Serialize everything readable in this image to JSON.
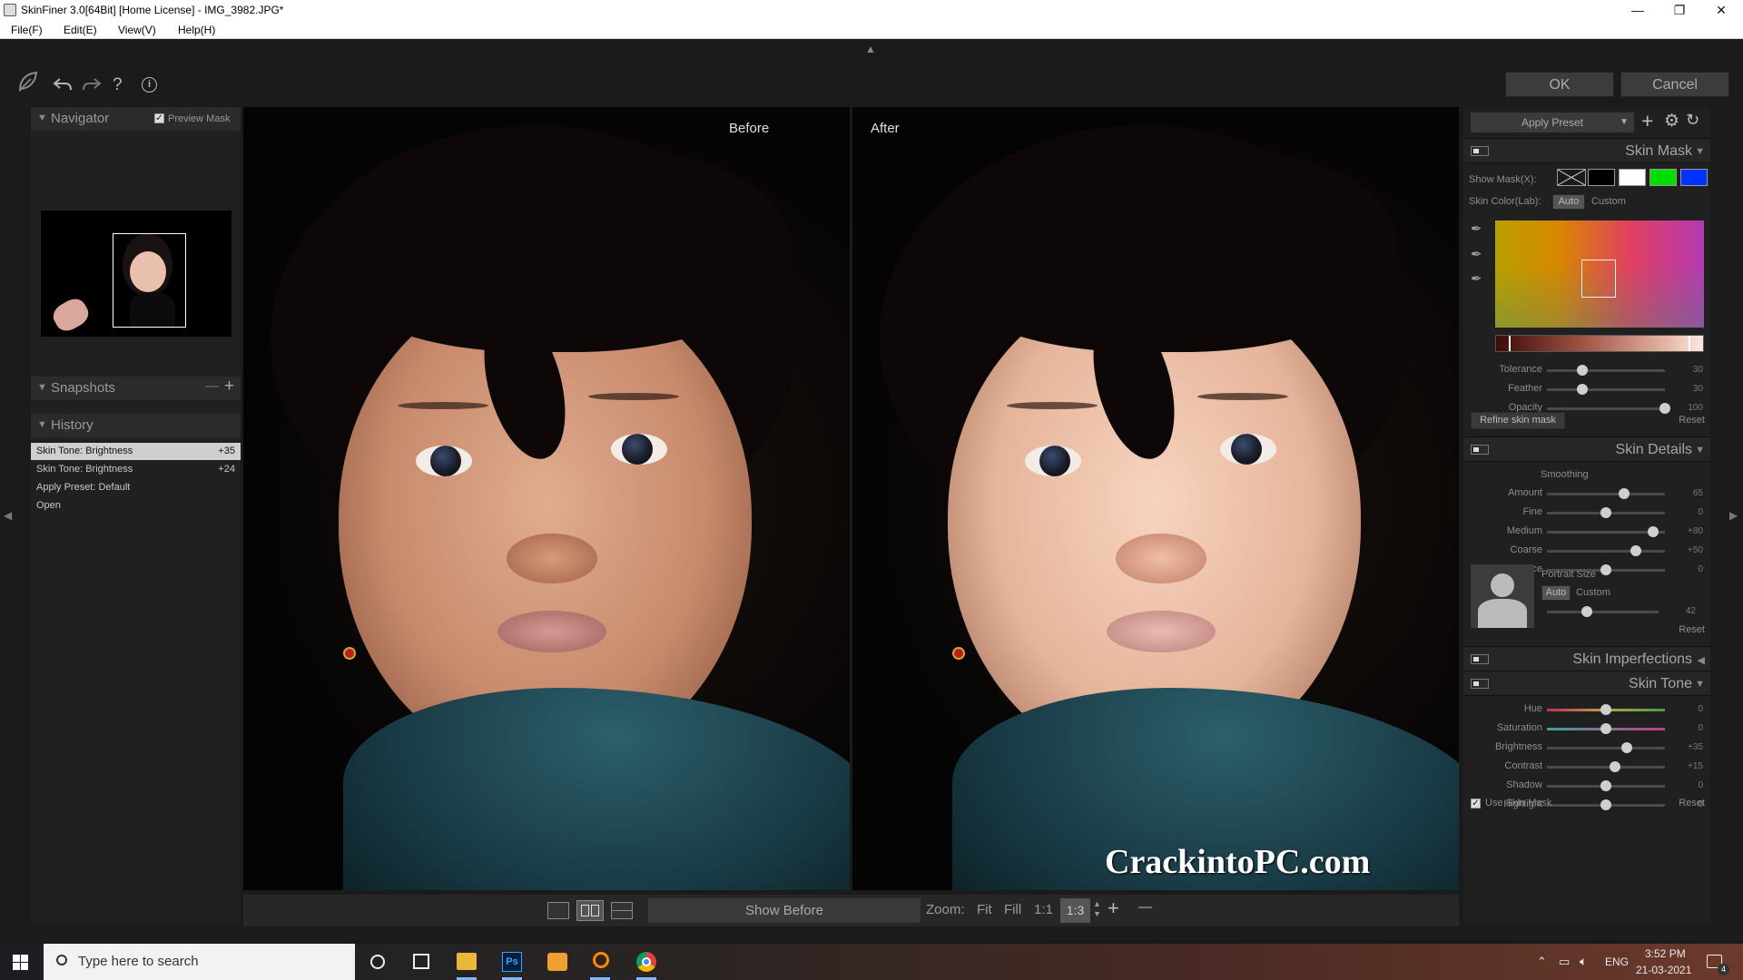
{
  "window": {
    "title": "SkinFiner 3.0[64Bit] [Home License] - IMG_3982.JPG*",
    "minimize": "—",
    "maximize": "❐",
    "close": "✕"
  },
  "menu": [
    "File(F)",
    "Edit(E)",
    "View(V)",
    "Help(H)"
  ],
  "toolbar": {
    "ok_label": "OK",
    "cancel_label": "Cancel",
    "help_glyph": "?",
    "info_glyph": "i"
  },
  "navigator": {
    "title": "Navigator",
    "preview_mask_label": "Preview Mask",
    "preview_mask_checked": true
  },
  "snapshots": {
    "title": "Snapshots",
    "remove_glyph": "—",
    "add_glyph": "+"
  },
  "history": {
    "title": "History",
    "items": [
      {
        "label": "Skin Tone: Brightness",
        "value": "+35"
      },
      {
        "label": "Skin Tone: Brightness",
        "value": "+24"
      },
      {
        "label": "Apply Preset: Default",
        "value": ""
      },
      {
        "label": "Open",
        "value": ""
      }
    ]
  },
  "viewer": {
    "before_label": "Before",
    "after_label": "After",
    "watermark": "CrackintoPC.com"
  },
  "bottombar": {
    "show_before_label": "Show Before",
    "zoom_label": "Zoom:",
    "fit": "Fit",
    "fill": "Fill",
    "one_to_one": "1:1",
    "zoom_value": "1:3",
    "zoom_in": "+",
    "zoom_out": "—"
  },
  "right": {
    "apply_preset_label": "Apply Preset",
    "skin_mask": {
      "title": "Skin Mask",
      "show_mask_label": "Show Mask(X):",
      "mask_colors": [
        "#000000",
        "#ffffff",
        "#00dd00",
        "#0033ff"
      ],
      "skin_color_label": "Skin Color(Lab):",
      "auto": "Auto",
      "custom": "Custom",
      "sliders": [
        {
          "label": "Tolerance",
          "value": "30",
          "pos": 0.3
        },
        {
          "label": "Feather",
          "value": "30",
          "pos": 0.3
        },
        {
          "label": "Opacity",
          "value": "100",
          "pos": 1.0
        }
      ],
      "refine_label": "Refine skin mask",
      "reset": "Reset"
    },
    "skin_details": {
      "title": "Skin Details",
      "smoothing_label": "Smoothing",
      "sliders": [
        {
          "label": "Amount",
          "value": "65",
          "pos": 0.65
        },
        {
          "label": "Fine",
          "value": "0",
          "pos": 0.5
        },
        {
          "label": "Medium",
          "value": "+80",
          "pos": 0.9
        },
        {
          "label": "Coarse",
          "value": "+50",
          "pos": 0.75
        },
        {
          "label": "Balance",
          "value": "0",
          "pos": 0.5
        }
      ],
      "portrait_size_label": "Portrait Size",
      "auto": "Auto",
      "custom": "Custom",
      "portrait_value": "42",
      "portrait_pos": 0.36,
      "reset": "Reset"
    },
    "skin_imperfections": {
      "title": "Skin Imperfections"
    },
    "skin_tone": {
      "title": "Skin Tone",
      "sliders": [
        {
          "label": "Hue",
          "value": "0",
          "pos": 0.5
        },
        {
          "label": "Saturation",
          "value": "0",
          "pos": 0.5
        },
        {
          "label": "Brightness",
          "value": "+35",
          "pos": 0.675
        },
        {
          "label": "Contrast",
          "value": "+15",
          "pos": 0.575
        },
        {
          "label": "Shadow",
          "value": "0",
          "pos": 0.5
        },
        {
          "label": "Highlight",
          "value": "0",
          "pos": 0.5
        }
      ],
      "use_skin_mask_label": "Use Skin Mask",
      "reset": "Reset"
    }
  },
  "taskbar": {
    "search_placeholder": "Type here to search",
    "lang": "ENG",
    "time": "3:52 PM",
    "date": "21-03-2021",
    "notifications": "4"
  },
  "colors": {
    "accent_green": "#00dd00",
    "accent_blue": "#0033ff",
    "panel_bg": "#202020"
  }
}
